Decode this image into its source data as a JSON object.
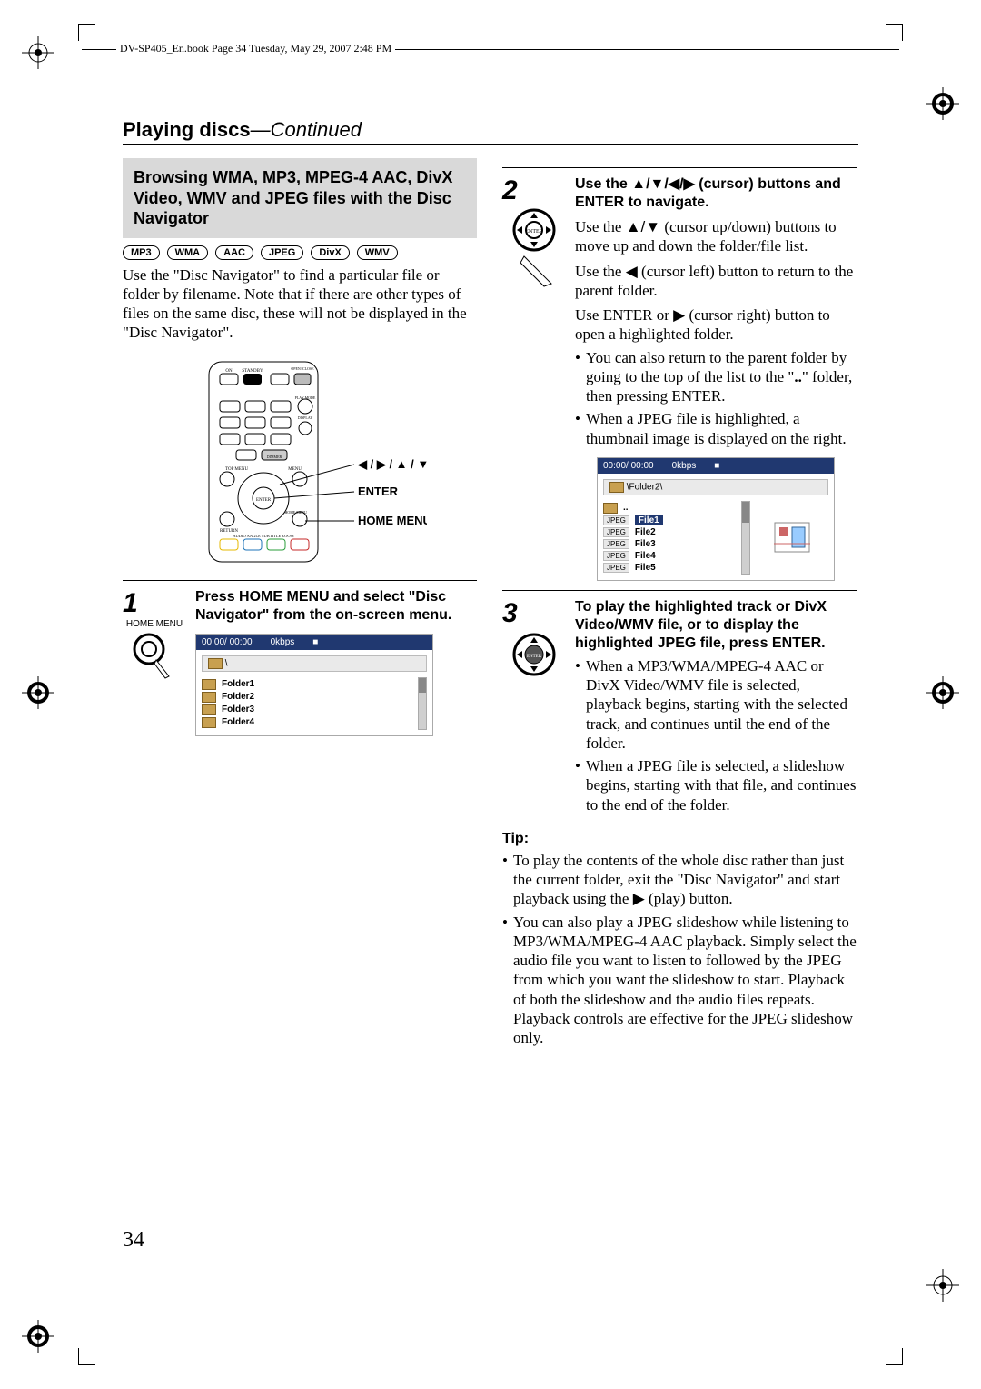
{
  "header_text": "DV-SP405_En.book  Page 34  Tuesday, May 29, 2007  2:48 PM",
  "section": {
    "main": "Playing discs",
    "cont": "—Continued"
  },
  "boxhead": "Browsing WMA, MP3, MPEG-4 AAC, DivX Video, WMV and JPEG files with the Disc Navigator",
  "badges": [
    "MP3",
    "WMA",
    "AAC",
    "JPEG",
    "DivX",
    "WMV"
  ],
  "intro": "Use the \"Disc Navigator\" to find a particular file or folder by filename. Note that if there are other types of files on the same disc, these will not be displayed in the \"Disc Navigator\".",
  "remote_labels": {
    "cursor": "◀ / ▶ / ▲ / ▼",
    "enter": "ENTER",
    "home": "HOME MENU"
  },
  "remote_small": {
    "topmenu": "TOP MENU",
    "menu": "MENU",
    "enter": "ENTER",
    "home": "HOME\nMENU",
    "return": "RETURN",
    "on": "ON",
    "standby": "STANDBY",
    "open": "OPEN/\nCLOSE",
    "play": "PLAY\nMODE",
    "display": "DISPLAY",
    "row": "AUDIO  ANGLE  SUBTITLE  ZOOM",
    "dimmer": "DIMMER"
  },
  "step1": {
    "num": "1",
    "ico_label": "HOME\nMENU",
    "head": "Press HOME MENU and select \"Disc Navigator\" from the on-screen menu.",
    "panel": {
      "bar_time": "00:00/ 00:00",
      "bar_rate": "0kbps",
      "bar_state": "■",
      "crumb": "\\",
      "items": [
        "Folder1",
        "Folder2",
        "Folder3",
        "Folder4"
      ]
    }
  },
  "step2": {
    "num": "2",
    "head": "Use the ▲/▼/◀/▶ (cursor) buttons and ENTER to navigate.",
    "p1a": "Use the ",
    "p1b": " (cursor up/down) buttons to move up and down the folder/file list.",
    "cursor_ud": "▲/▼",
    "p2a": "Use the ",
    "p2b": " (cursor left) button to return to the parent folder.",
    "cursor_l": "◀",
    "p3a": "Use ENTER or ",
    "p3b": " (cursor right) button to open a highlighted folder.",
    "cursor_r": "▶",
    "b1a": "You can also return to the parent folder by going to the top of the list to the \"",
    "b1dots": "..",
    "b1b": "\" folder, then pressing ENTER.",
    "b2": "When a JPEG file is highlighted, a thumbnail image is displayed on the right.",
    "panel": {
      "bar_time": "00:00/ 00:00",
      "bar_rate": "0kbps",
      "bar_state": "■",
      "crumb": "\\Folder2\\",
      "dots": "..",
      "jpeg": "JPEG",
      "items": [
        "File1",
        "File2",
        "File3",
        "File4",
        "File5"
      ]
    }
  },
  "step3": {
    "num": "3",
    "head": "To play the highlighted track or DivX Video/WMV file, or to display the highlighted JPEG file, press ENTER.",
    "b1": "When a MP3/WMA/MPEG-4 AAC or DivX Video/WMV file is selected, playback begins, starting with the selected track, and continues until the end of the folder.",
    "b2": "When a JPEG file is selected, a slideshow begins, starting with that file, and continues to the end of the folder."
  },
  "tip": {
    "head": "Tip:",
    "b1a": "To play the contents of the whole disc rather than just the current folder, exit the \"Disc Navigator\" and start playback using the ",
    "b1p": "▶",
    "b1b": " (play) button.",
    "b2": "You can also play a JPEG slideshow while listening to MP3/WMA/MPEG-4 AAC playback. Simply select the audio file you want to listen to followed by the JPEG from which you want the slideshow to start. Playback of both the slideshow and the audio files repeats. Playback controls are effective for the JPEG slideshow only."
  },
  "page_number": "34"
}
